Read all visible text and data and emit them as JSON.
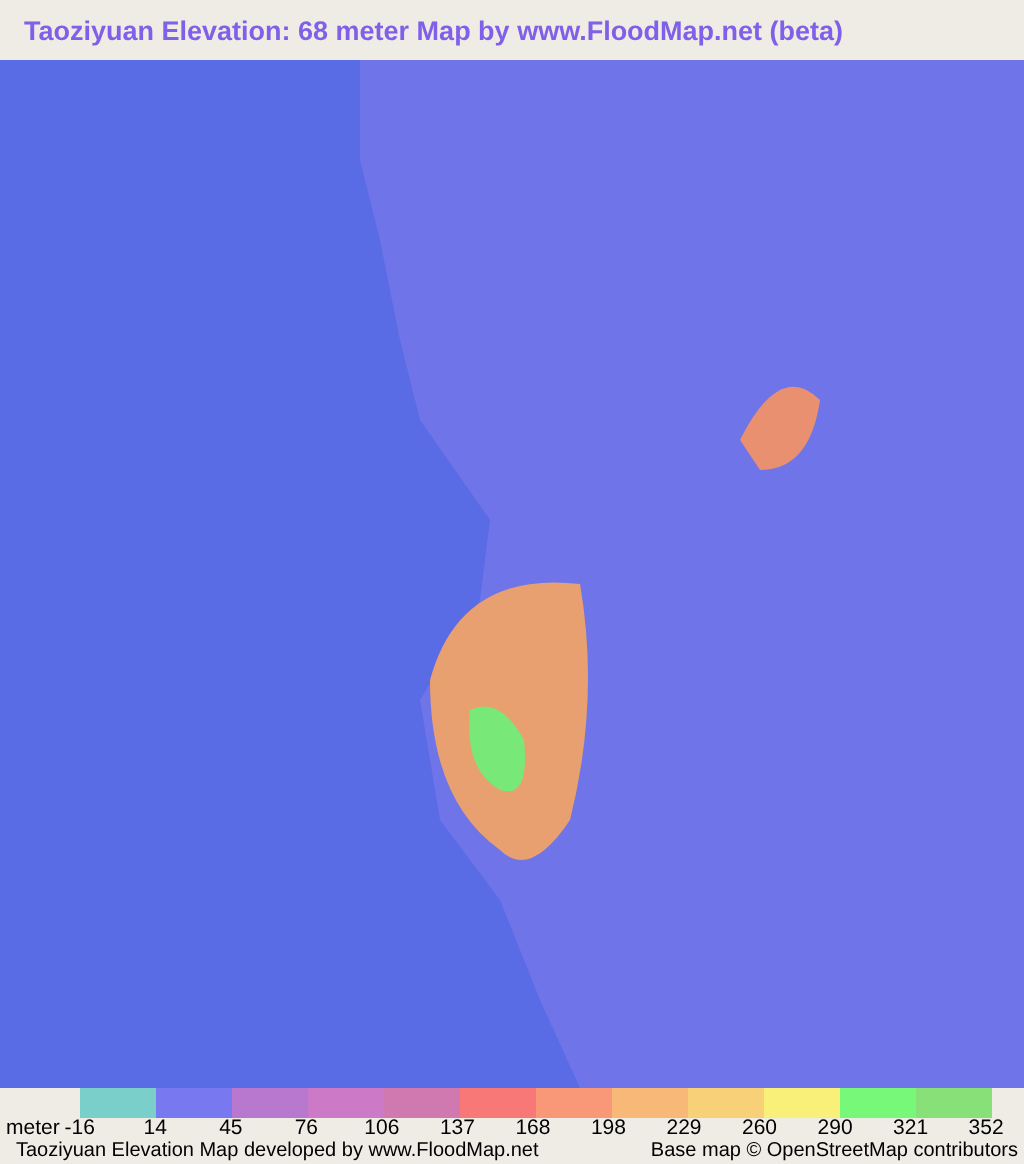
{
  "title": "Taoziyuan Elevation: 68 meter Map by www.FloodMap.net (beta)",
  "legend": {
    "unit": "meter",
    "swatches": [
      {
        "color": "#7acfcb"
      },
      {
        "color": "#7878f0"
      },
      {
        "color": "#b878d0"
      },
      {
        "color": "#cc7ac8"
      },
      {
        "color": "#d078b0"
      },
      {
        "color": "#f87878"
      },
      {
        "color": "#f89878"
      },
      {
        "color": "#f8b878"
      },
      {
        "color": "#f8d078"
      },
      {
        "color": "#f8f078"
      },
      {
        "color": "#78f878"
      },
      {
        "color": "#88e078"
      }
    ],
    "ticks": [
      "-16",
      "14",
      "45",
      "76",
      "106",
      "137",
      "168",
      "198",
      "229",
      "260",
      "290",
      "321",
      "352"
    ]
  },
  "footer": {
    "credit": "Taoziyuan Elevation Map developed by www.FloodMap.net",
    "attribution": "Base map © OpenStreetMap contributors"
  }
}
